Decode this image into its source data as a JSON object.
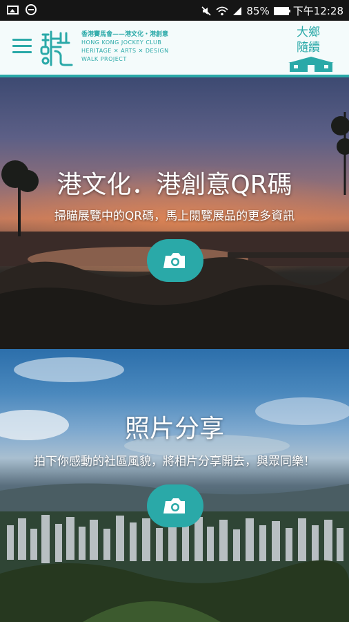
{
  "status_bar": {
    "battery": "85%",
    "time": "下午12:28"
  },
  "header": {
    "logo_title": "香港賽馬會——港文化・港創意",
    "logo_sub_1": "HONG KONG JOCKEY CLUB",
    "logo_sub_2": "HERITAGE ✕ ARTS ✕ DESIGN",
    "logo_sub_3": "WALK PROJECT",
    "badge_title_1": "大鄉",
    "badge_title_2": "隨續"
  },
  "panels": [
    {
      "title": "港文化．港創意QR碼",
      "subtitle": "掃瞄展覽中的QR碼，馬上閱覽展品的更多資訊"
    },
    {
      "title": "照片分享",
      "subtitle": "拍下你感動的社區風貌，將相片分享開去，與眾同樂！"
    }
  ],
  "colors": {
    "accent": "#2aa9a8",
    "header_bg": "#f4fbfb",
    "status_bg": "#151515"
  },
  "icons": [
    "image-icon",
    "dnd-icon",
    "mute-icon",
    "wifi-icon",
    "battery-icon",
    "menu-icon",
    "camera-icon"
  ]
}
